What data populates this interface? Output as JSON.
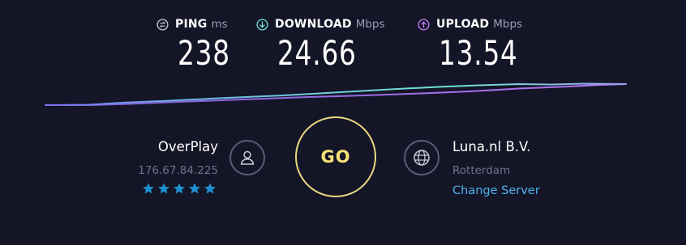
{
  "metrics": {
    "ping": {
      "label": "PING",
      "unit": "ms",
      "value": "238",
      "icon": "ping-icon",
      "color": "#c9cbd8"
    },
    "download": {
      "label": "DOWNLOAD",
      "unit": "Mbps",
      "value": "24.66",
      "icon": "download-arrow-icon",
      "color": "#6fe3d3"
    },
    "upload": {
      "label": "UPLOAD",
      "unit": "Mbps",
      "value": "13.54",
      "icon": "upload-arrow-icon",
      "color": "#c07bf0"
    }
  },
  "provider": {
    "name": "OverPlay",
    "ip": "176.67.84.225",
    "rating": 5,
    "rating_max": 5,
    "icon": "user-icon"
  },
  "go_button": {
    "label": "GO",
    "color": "#f4e27a"
  },
  "server": {
    "name": "Luna.nl B.V.",
    "city": "Rotterdam",
    "change_label": "Change Server",
    "icon": "globe-icon",
    "link_color": "#4fb2f0"
  },
  "colors": {
    "background": "#141526",
    "download_line": "#6fe3d3",
    "upload_line": "#a56cf0",
    "star": "#1f8fd0"
  }
}
